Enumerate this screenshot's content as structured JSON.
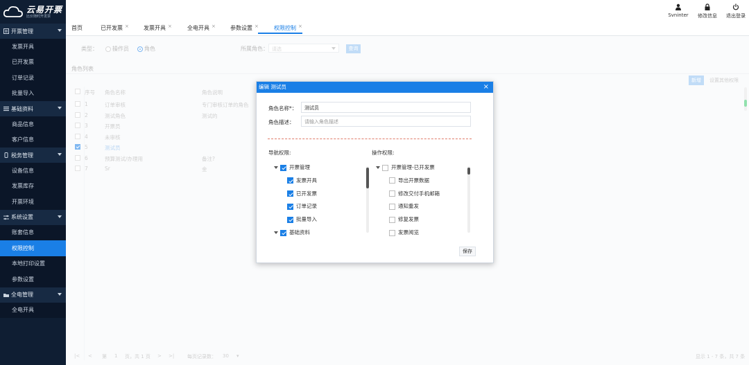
{
  "sidebar": {
    "logo_title": "云易开票",
    "logo_sub": "比价随时开发票",
    "groups": [
      {
        "label": "开票管理",
        "icon": "invoice-icon",
        "items": [
          "发票开具",
          "已开发票",
          "订单记录",
          "批量导入"
        ]
      },
      {
        "label": "基础资料",
        "icon": "list-icon",
        "items": [
          "商品信息",
          "客户信息"
        ]
      },
      {
        "label": "税务管理",
        "icon": "tax-icon",
        "items": [
          "设备信息",
          "发票库存",
          "开票环境"
        ]
      },
      {
        "label": "系统设置",
        "icon": "settings-icon",
        "items": [
          "账套信息",
          "权限控制",
          "本地打印设置",
          "参数设置"
        ]
      },
      {
        "label": "全电管理",
        "icon": "folder-icon",
        "items": [
          "全电开具"
        ]
      }
    ],
    "active_item": "权限控制"
  },
  "topbar": {
    "user": "Svninter",
    "change_info": "修改信息",
    "logout": "退出登录"
  },
  "tabs": [
    {
      "label": "首页",
      "closable": false
    },
    {
      "label": "已开发票",
      "closable": true
    },
    {
      "label": "发票开具",
      "closable": true
    },
    {
      "label": "全电开具",
      "closable": true
    },
    {
      "label": "参数设置",
      "closable": true
    },
    {
      "label": "权限控制",
      "closable": true,
      "active": true
    }
  ],
  "filter": {
    "type_label": "类型：",
    "operator_option": "操作员",
    "role_option": "角色",
    "role_select_label": "所属角色：",
    "role_select_placeholder": "请选",
    "query_button": "查询"
  },
  "list": {
    "title": "角色列表",
    "add_button": "新增",
    "set_perm_button": "设置其他权限",
    "headers": [
      "序号",
      "角色名称",
      "角色说明"
    ],
    "rows": [
      {
        "no": "1",
        "name": "订单审核",
        "desc": "专门审核订单的角色",
        "checked": false
      },
      {
        "no": "2",
        "name": "测试角色",
        "desc": "测试的",
        "checked": false
      },
      {
        "no": "3",
        "name": "开票员",
        "desc": "",
        "checked": false
      },
      {
        "no": "4",
        "name": "未审核",
        "desc": "",
        "checked": false
      },
      {
        "no": "5",
        "name": "测试员",
        "desc": "",
        "checked": true
      },
      {
        "no": "6",
        "name": "预算测试/办理用",
        "desc": "备注?",
        "checked": false
      },
      {
        "no": "7",
        "name": "Sr",
        "desc": "金",
        "checked": false
      }
    ]
  },
  "pager": {
    "page_label": "第",
    "page_value": "1",
    "page_total": "页，共 1 页",
    "per_page_label": "每页记录数：",
    "per_page_value": "30",
    "summary": "显示 1 - 7 条，共 7 条"
  },
  "modal": {
    "title": "编辑 测试员",
    "close": "×",
    "name_label": "角色名称*：",
    "name_value": "测试员",
    "desc_label": "角色描述：",
    "desc_placeholder": "请输入角色描述",
    "nav_perm_label": "导航权限:",
    "op_perm_label": "操作权限:",
    "nav_tree": [
      {
        "label": "开票管理",
        "level": 0,
        "checked": true,
        "expand": true
      },
      {
        "label": "发票开具",
        "level": 1,
        "checked": true
      },
      {
        "label": "已开发票",
        "level": 1,
        "checked": true
      },
      {
        "label": "订单记录",
        "level": 1,
        "checked": true
      },
      {
        "label": "批量导入",
        "level": 1,
        "checked": true
      },
      {
        "label": "基础资料",
        "level": 0,
        "checked": true,
        "expand": true
      }
    ],
    "op_tree": [
      {
        "label": "开票管理-已开发票",
        "level": 0,
        "checked": false,
        "expand": true
      },
      {
        "label": "导出开票数据",
        "level": 1,
        "checked": false
      },
      {
        "label": "修改交付手机邮箱",
        "level": 1,
        "checked": false
      },
      {
        "label": "通知重发",
        "level": 1,
        "checked": false
      },
      {
        "label": "修复发票",
        "level": 1,
        "checked": false
      },
      {
        "label": "发票阅览",
        "level": 1,
        "checked": false
      }
    ],
    "save_button": "保存"
  }
}
